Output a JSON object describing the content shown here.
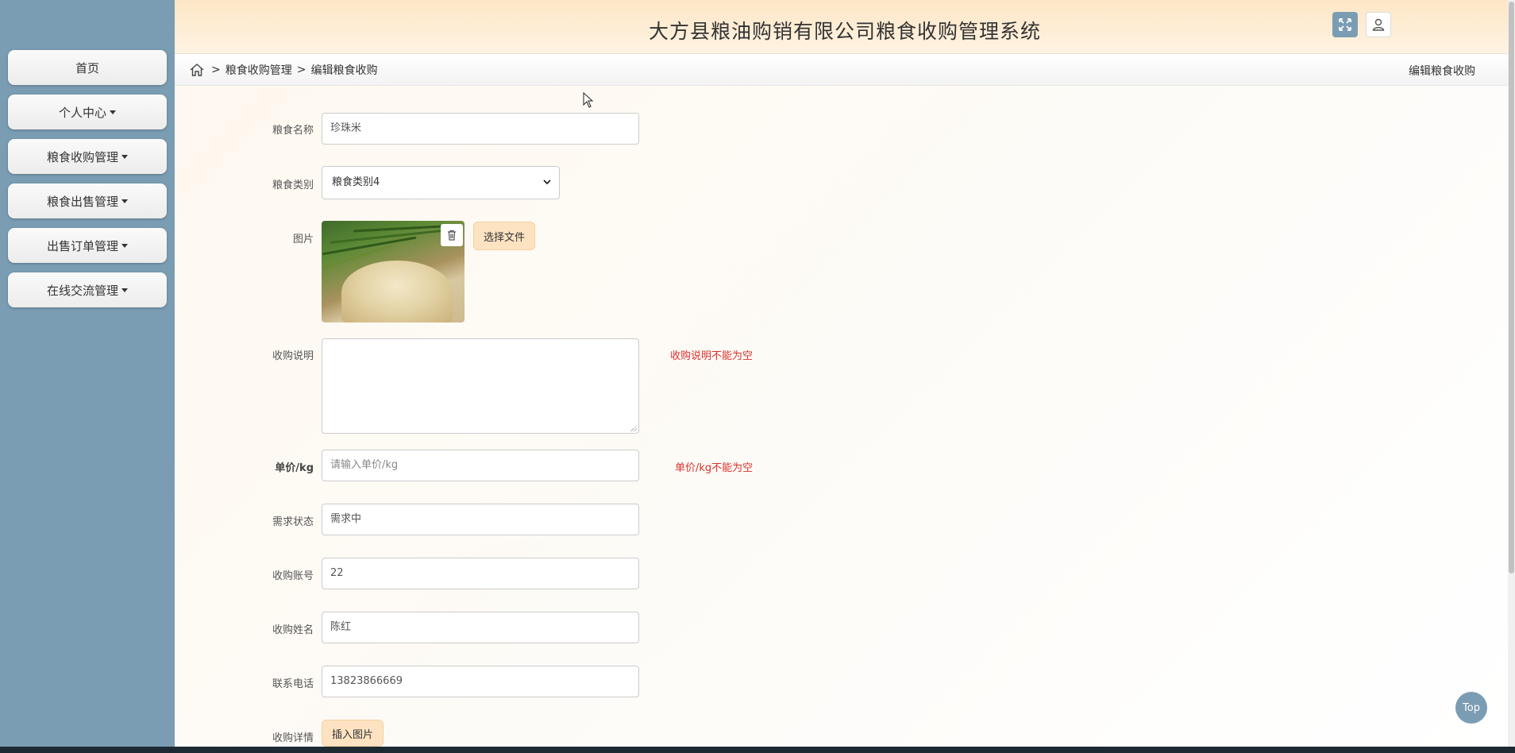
{
  "app": {
    "title": "大方县粮油购销有限公司粮食收购管理系统"
  },
  "sidebar": {
    "items": [
      {
        "label": "首页",
        "has_caret": false
      },
      {
        "label": "个人中心",
        "has_caret": true
      },
      {
        "label": "粮食收购管理",
        "has_caret": true
      },
      {
        "label": "粮食出售管理",
        "has_caret": true
      },
      {
        "label": "出售订单管理",
        "has_caret": true
      },
      {
        "label": "在线交流管理",
        "has_caret": true
      }
    ]
  },
  "breadcrumb": {
    "sep": ">",
    "level1": "粮食收购管理",
    "level2": "编辑粮食收购",
    "right_title": "编辑粮食收购"
  },
  "form": {
    "name": {
      "label": "粮食名称",
      "value": "珍珠米"
    },
    "category": {
      "label": "粮食类别",
      "value": "粮食类别4"
    },
    "image": {
      "label": "图片",
      "choose_label": "选择文件"
    },
    "description": {
      "label": "收购说明",
      "value": "",
      "error": "收购说明不能为空"
    },
    "unit_price": {
      "label": "单价/kg",
      "placeholder": "请输入单价/kg",
      "error": "单价/kg不能为空"
    },
    "status": {
      "label": "需求状态",
      "value": "需求中"
    },
    "account": {
      "label": "收购账号",
      "value": "22"
    },
    "buyer_name": {
      "label": "收购姓名",
      "value": "陈红"
    },
    "phone": {
      "label": "联系电话",
      "value": "13823866669"
    },
    "detail": {
      "label": "收购详情",
      "insert_label": "插入图片"
    }
  },
  "top_button": {
    "label": "Top"
  },
  "icons": {
    "home": "home-icon",
    "expand": "fullscreen-icon",
    "user": "user-icon",
    "trash": "trash-icon"
  },
  "colors": {
    "sidebar": "#7b9db3",
    "header": "#fde6c6",
    "accent_button": "#fde3c2",
    "error": "#d9312c"
  }
}
